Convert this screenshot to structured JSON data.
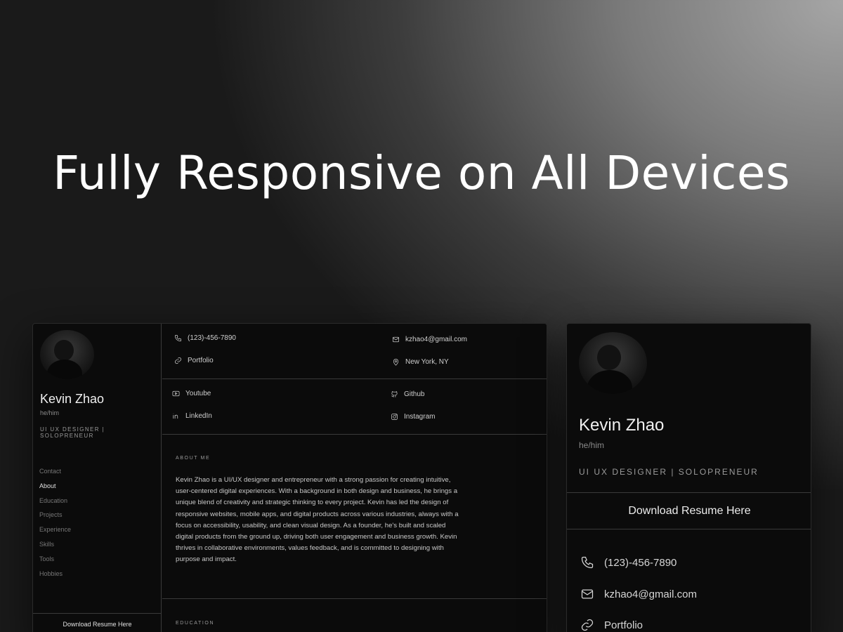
{
  "headline": "Fully Responsive on All Devices",
  "profile": {
    "name": "Kevin Zhao",
    "pronouns": "he/him",
    "role": "UI UX DESIGNER | SOLOPRENEUR",
    "download_label": "Download Resume Here"
  },
  "nav": {
    "items": [
      "Contact",
      "About",
      "Education",
      "Projects",
      "Experience",
      "Skills",
      "Tools",
      "Hobbies"
    ],
    "active": "About"
  },
  "contact": {
    "phone": "(123)-456-7890",
    "email": "kzhao4@gmail.com",
    "portfolio": "Portfolio",
    "location": "New York, NY"
  },
  "social": {
    "youtube": "Youtube",
    "github": "Github",
    "linkedin": "LinkedIn",
    "instagram": "Instagram"
  },
  "about": {
    "title": "ABOUT ME",
    "text": "Kevin Zhao is a UI/UX designer and entrepreneur with a strong passion for creating intuitive, user-centered digital experiences. With a background in both design and business, he brings a unique blend of creativity and strategic thinking to every project. Kevin has led the design of responsive websites, mobile apps, and digital products across various industries, always with a focus on accessibility, usability, and clean visual design. As a founder, he's built and scaled digital products from the ground up, driving both user engagement and business growth. Kevin thrives in collaborative environments, values feedback, and is committed to designing with purpose and impact."
  },
  "education": {
    "title": "EDUCATION"
  },
  "icons": {
    "phone": "phone-icon",
    "email": "mail-icon",
    "portfolio": "link-icon",
    "location": "map-pin-icon",
    "youtube": "youtube-icon",
    "github": "github-icon",
    "linkedin": "linkedin-icon",
    "instagram": "instagram-icon"
  }
}
